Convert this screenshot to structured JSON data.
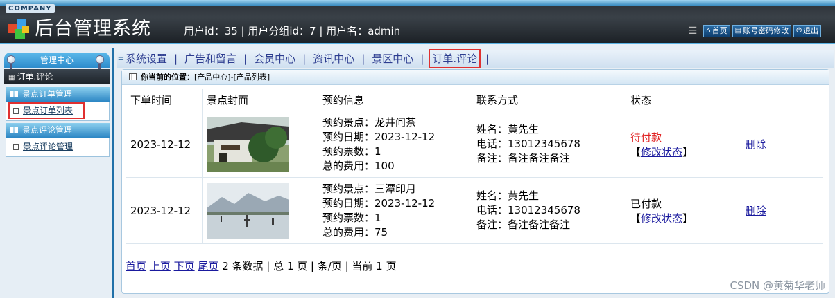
{
  "header": {
    "company": "COMPANY",
    "title": "后台管理系统",
    "user_info": "用户id：35 | 用户分组id：7 | 用户名：admin",
    "links": [
      {
        "label": "首页",
        "icon": "home-icon"
      },
      {
        "label": "账号密码修改",
        "icon": "account-icon"
      },
      {
        "label": "退出",
        "icon": "power-icon"
      }
    ]
  },
  "sidebar": {
    "title": "管理中心",
    "current": "订单.评论",
    "groups": [
      {
        "title": "景点订单管理",
        "items": [
          "景点订单列表"
        ]
      },
      {
        "title": "景点评论管理",
        "items": [
          "景点评论管理"
        ]
      }
    ]
  },
  "topnav": [
    "系统设置",
    "广告和留言",
    "会员中心",
    "资讯中心",
    "景区中心",
    "订单.评论"
  ],
  "location": {
    "label": "你当前的位置：",
    "path": "[产品中心]-[产品列表]"
  },
  "table": {
    "headers": [
      "下单时间",
      "景点封面",
      "预约信息",
      "联系方式",
      "状态",
      ""
    ],
    "rows": [
      {
        "date": "2023-12-12",
        "spot": "预约景点：龙井问茶",
        "book_date": "预约日期：2023-12-12",
        "tickets": "预约票数：1",
        "fee": "总的费用：100",
        "name": "姓名：黄先生",
        "phone": "电话：13012345678",
        "note": "备注：备注备注备注",
        "status": "待付款",
        "status_color": "#e02020",
        "modify": "修改状态",
        "delete": "删除"
      },
      {
        "date": "2023-12-12",
        "spot": "预约景点：三潭印月",
        "book_date": "预约日期：2023-12-12",
        "tickets": "预约票数：1",
        "fee": "总的费用：75",
        "name": "姓名：黄先生",
        "phone": "电话：13012345678",
        "note": "备注：备注备注备注",
        "status": "已付款",
        "status_color": "#000000",
        "modify": "修改状态",
        "delete": "删除"
      }
    ]
  },
  "pager": {
    "first": "首页",
    "prev": "上页",
    "next": "下页",
    "last": "尾页",
    "summary": "2 条数据 | 总 1 页 | 条/页 | 当前 1 页"
  },
  "watermark": "CSDN @黄菊华老师"
}
